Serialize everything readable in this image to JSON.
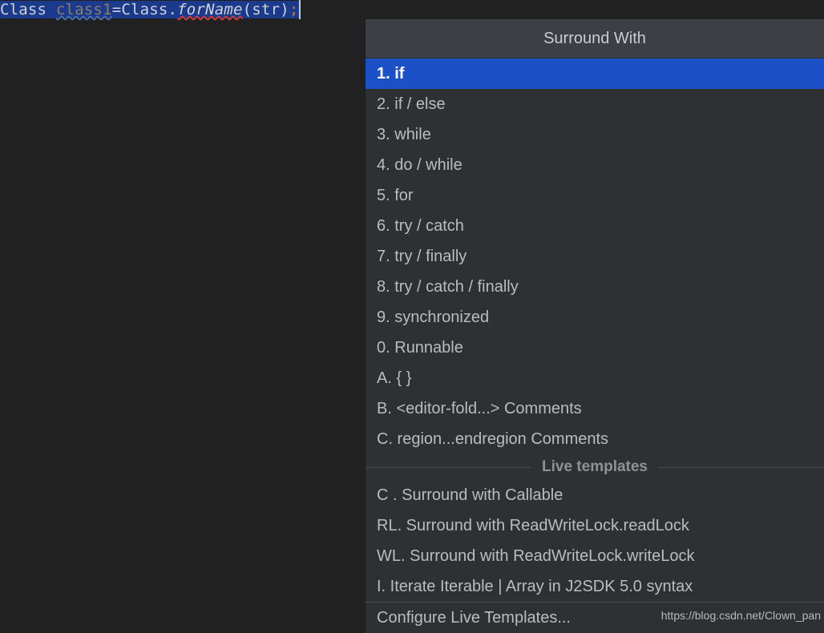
{
  "editor": {
    "code": {
      "segments": [
        {
          "text": "Class",
          "kind": "type"
        },
        {
          "text": " ",
          "kind": "space"
        },
        {
          "text": "class1",
          "kind": "var-squiggle-blue"
        },
        {
          "text": "=",
          "kind": "op"
        },
        {
          "text": "Class",
          "kind": "type"
        },
        {
          "text": ".",
          "kind": "punc"
        },
        {
          "text": "forName",
          "kind": "method-squiggle-red"
        },
        {
          "text": "(",
          "kind": "punc"
        },
        {
          "text": "str",
          "kind": "plain"
        },
        {
          "text": ")",
          "kind": "punc"
        },
        {
          "text": ";",
          "kind": "semi"
        }
      ],
      "full_text": "Class class1=Class.forName(str);"
    },
    "background_color": "#212121",
    "selection_color": "#1b3a8c"
  },
  "popup": {
    "title": "Surround With",
    "header_color": "#3c4045",
    "list_background": "#2e3133",
    "selection_color": "#1b50c6",
    "text_color": "#b8bdc0",
    "items": [
      {
        "mnemonic": "1.",
        "label": "if",
        "selected": true
      },
      {
        "mnemonic": "2.",
        "label": "if / else",
        "selected": false
      },
      {
        "mnemonic": "3.",
        "label": "while",
        "selected": false
      },
      {
        "mnemonic": "4.",
        "label": "do / while",
        "selected": false
      },
      {
        "mnemonic": "5.",
        "label": "for",
        "selected": false
      },
      {
        "mnemonic": "6.",
        "label": "try / catch",
        "selected": false
      },
      {
        "mnemonic": "7.",
        "label": "try / finally",
        "selected": false
      },
      {
        "mnemonic": "8.",
        "label": "try / catch / finally",
        "selected": false
      },
      {
        "mnemonic": "9.",
        "label": "synchronized",
        "selected": false
      },
      {
        "mnemonic": "0.",
        "label": "Runnable",
        "selected": false
      },
      {
        "mnemonic": "A.",
        "label": "{ }",
        "selected": false
      },
      {
        "mnemonic": "B.",
        "label": "<editor-fold...> Comments",
        "selected": false
      },
      {
        "mnemonic": "C.",
        "label": "region...endregion Comments",
        "selected": false
      }
    ],
    "group_separator": {
      "caption": "Live templates"
    },
    "live_templates": [
      {
        "mnemonic": "C .",
        "label": "Surround with Callable"
      },
      {
        "mnemonic": "RL.",
        "label": "Surround with ReadWriteLock.readLock"
      },
      {
        "mnemonic": "WL.",
        "label": "Surround with ReadWriteLock.writeLock"
      },
      {
        "mnemonic": "I.",
        "label": "Iterate Iterable | Array in J2SDK 5.0 syntax"
      }
    ],
    "configure_action": "Configure Live Templates..."
  },
  "watermark": {
    "text": "https://blog.csdn.net/Clown_pan"
  }
}
